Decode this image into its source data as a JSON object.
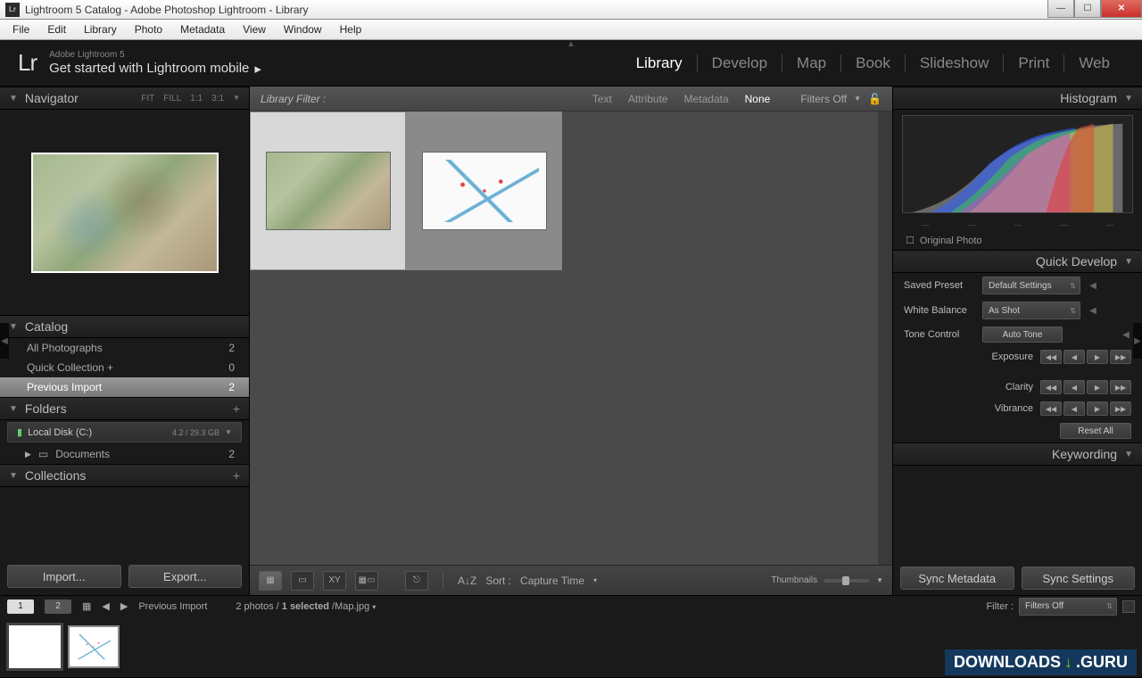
{
  "window": {
    "title": "Lightroom 5 Catalog - Adobe Photoshop Lightroom - Library",
    "logo_small": "Lr"
  },
  "menubar": [
    "File",
    "Edit",
    "Library",
    "Photo",
    "Metadata",
    "View",
    "Window",
    "Help"
  ],
  "brand": {
    "logo": "Lr",
    "sub1": "Adobe Lightroom 5",
    "sub2": "Get started with Lightroom mobile"
  },
  "modules": [
    {
      "label": "Library",
      "active": true
    },
    {
      "label": "Develop",
      "active": false
    },
    {
      "label": "Map",
      "active": false
    },
    {
      "label": "Book",
      "active": false
    },
    {
      "label": "Slideshow",
      "active": false
    },
    {
      "label": "Print",
      "active": false
    },
    {
      "label": "Web",
      "active": false
    }
  ],
  "navigator": {
    "title": "Navigator",
    "opts": [
      "FIT",
      "FILL",
      "1:1",
      "3:1"
    ]
  },
  "catalog": {
    "title": "Catalog",
    "items": [
      {
        "label": "All Photographs",
        "count": "2",
        "sel": false
      },
      {
        "label": "Quick Collection  +",
        "count": "0",
        "sel": false
      },
      {
        "label": "Previous Import",
        "count": "2",
        "sel": true
      }
    ]
  },
  "folders": {
    "title": "Folders",
    "disk": {
      "name": "Local Disk (C:)",
      "usage": "4.2 / 29.3 GB"
    },
    "items": [
      {
        "label": "Documents",
        "count": "2"
      }
    ]
  },
  "collections": {
    "title": "Collections"
  },
  "buttons": {
    "import": "Import...",
    "export": "Export..."
  },
  "filter": {
    "label": "Library Filter :",
    "tabs": [
      "Text",
      "Attribute",
      "Metadata",
      "None"
    ],
    "active": "None",
    "state": "Filters Off"
  },
  "toolbar": {
    "sort_label": "Sort :",
    "sort_value": "Capture Time",
    "thumbs": "Thumbnails"
  },
  "histogram": {
    "title": "Histogram",
    "original": "Original Photo"
  },
  "quickdev": {
    "title": "Quick Develop",
    "preset_label": "Saved Preset",
    "preset_value": "Default Settings",
    "wb_label": "White Balance",
    "wb_value": "As Shot",
    "tone_label": "Tone Control",
    "auto": "Auto Tone",
    "exposure": "Exposure",
    "clarity": "Clarity",
    "vibrance": "Vibrance",
    "reset": "Reset All"
  },
  "keywording": {
    "title": "Keywording"
  },
  "sync": {
    "meta": "Sync Metadata",
    "settings": "Sync Settings"
  },
  "status": {
    "page1": "1",
    "page2": "2",
    "context": "Previous Import",
    "count": "2 photos /",
    "selected": "1 selected",
    "file": " /Map.jpg",
    "filter_label": "Filter :",
    "filter_value": "Filters Off"
  },
  "watermark": {
    "t1": "DOWNLOADS",
    "t2": ".GURU"
  }
}
